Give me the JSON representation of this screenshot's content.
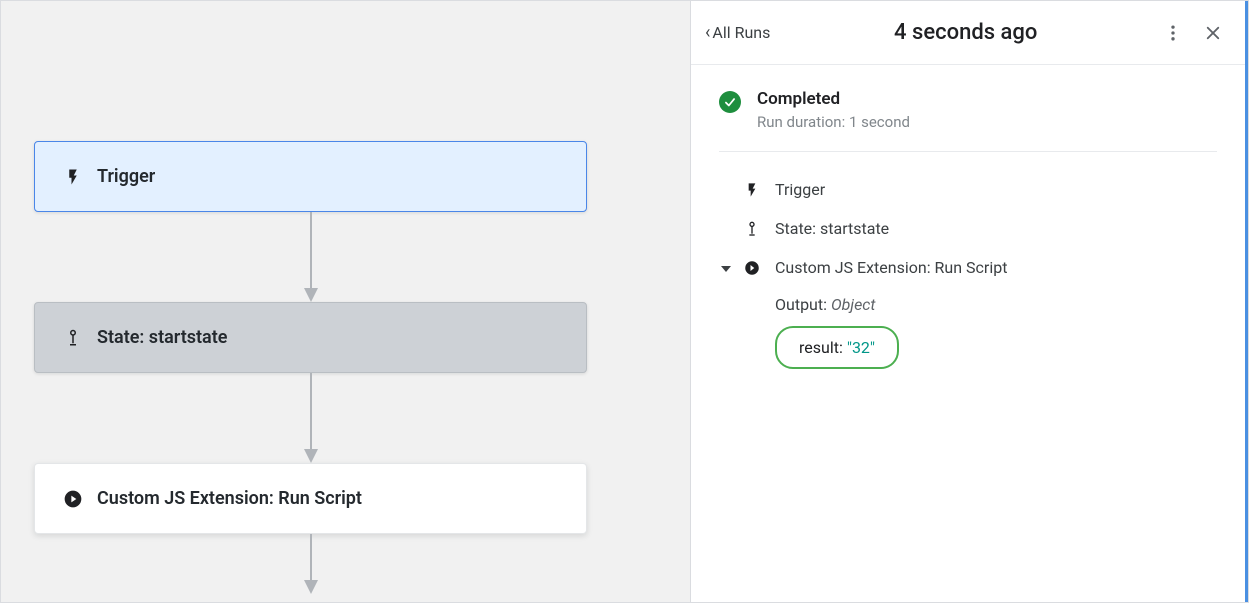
{
  "flow": {
    "nodes": [
      {
        "label": "Trigger"
      },
      {
        "label": "State: startstate"
      },
      {
        "label": "Custom JS Extension: Run Script"
      }
    ]
  },
  "panel": {
    "back_label": "All Runs",
    "title": "4 seconds ago",
    "status": {
      "title": "Completed",
      "subtitle": "Run duration: 1 second"
    },
    "items": {
      "trigger": "Trigger",
      "state": "State: startstate",
      "step": "Custom JS Extension: Run Script"
    },
    "output": {
      "label": "Output: ",
      "type": "Object",
      "result_key": "result: ",
      "result_val": "\"32\""
    }
  }
}
